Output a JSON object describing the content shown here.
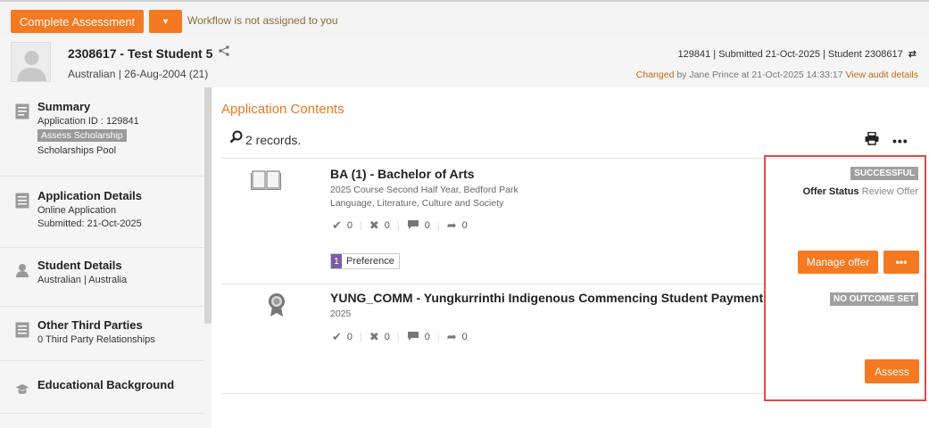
{
  "toolbar": {
    "complete_label": "Complete Assessment",
    "dropdown_glyph": "▼",
    "workflow_message": "Workflow is not assigned to you"
  },
  "header": {
    "student_title": "2308617 - Test Student 5",
    "student_sub": "Australian | 26-Aug-2004 (21)",
    "application_info": "129841 | Submitted 21-Oct-2025 | Student 2308617",
    "changed_label": "Changed",
    "changed_text": " by Jane Prince  at 21-Oct-2025 14:33:17 ",
    "audit_link": "View audit details"
  },
  "sidebar": {
    "summary": {
      "title": "Summary",
      "line1": "Application ID : 129841",
      "badge": "Assess Scholarship",
      "line2": "Scholarships Pool"
    },
    "application_details": {
      "title": "Application Details",
      "line1": "Online Application",
      "line2": "Submitted: 21-Oct-2025"
    },
    "student_details": {
      "title": "Student Details",
      "line1": "Australian | Australia"
    },
    "third_parties": {
      "title": "Other Third Parties",
      "line1": "0 Third Party Relationships"
    },
    "educational": {
      "title": "Educational Background"
    }
  },
  "main": {
    "title": "Application Contents",
    "records_label": "2 records."
  },
  "records": [
    {
      "title": "BA (1) - Bachelor of Arts",
      "sub1": "2025 Course Second Half Year, Bedford Park",
      "sub2": "Language, Literature, Culture and Society",
      "counts": [
        "0",
        "0",
        "0",
        "0"
      ],
      "status": "SUCCESSFUL",
      "offer_status_label": "Offer Status",
      "offer_status_value": "Review Offer",
      "preference_num": "1",
      "preference_label": "Preference",
      "action_label": "Manage offer",
      "more_label": "•••"
    },
    {
      "title": "YUNG_COMM - Yungkurrinthi Indigenous Commencing Student Payment",
      "sub1": "2025",
      "counts": [
        "0",
        "0",
        "0",
        "0"
      ],
      "status": "NO OUTCOME SET",
      "action_label": "Assess"
    }
  ],
  "icons": {
    "share": "share-icon",
    "swap": "swap-arrows-icon",
    "search": "search-icon",
    "print": "print-icon",
    "more": "more-icon",
    "book": "book-icon",
    "award": "award-medal-icon",
    "check": "check-icon",
    "cross": "cross-icon",
    "comment": "comment-icon",
    "forward": "forward-arrow-icon"
  },
  "colors": {
    "accent": "#f47920",
    "title_orange": "#e87722",
    "badge_gray": "#a0a0a0",
    "preference_purple": "#7b5ea7",
    "highlight_red": "#e04848"
  }
}
